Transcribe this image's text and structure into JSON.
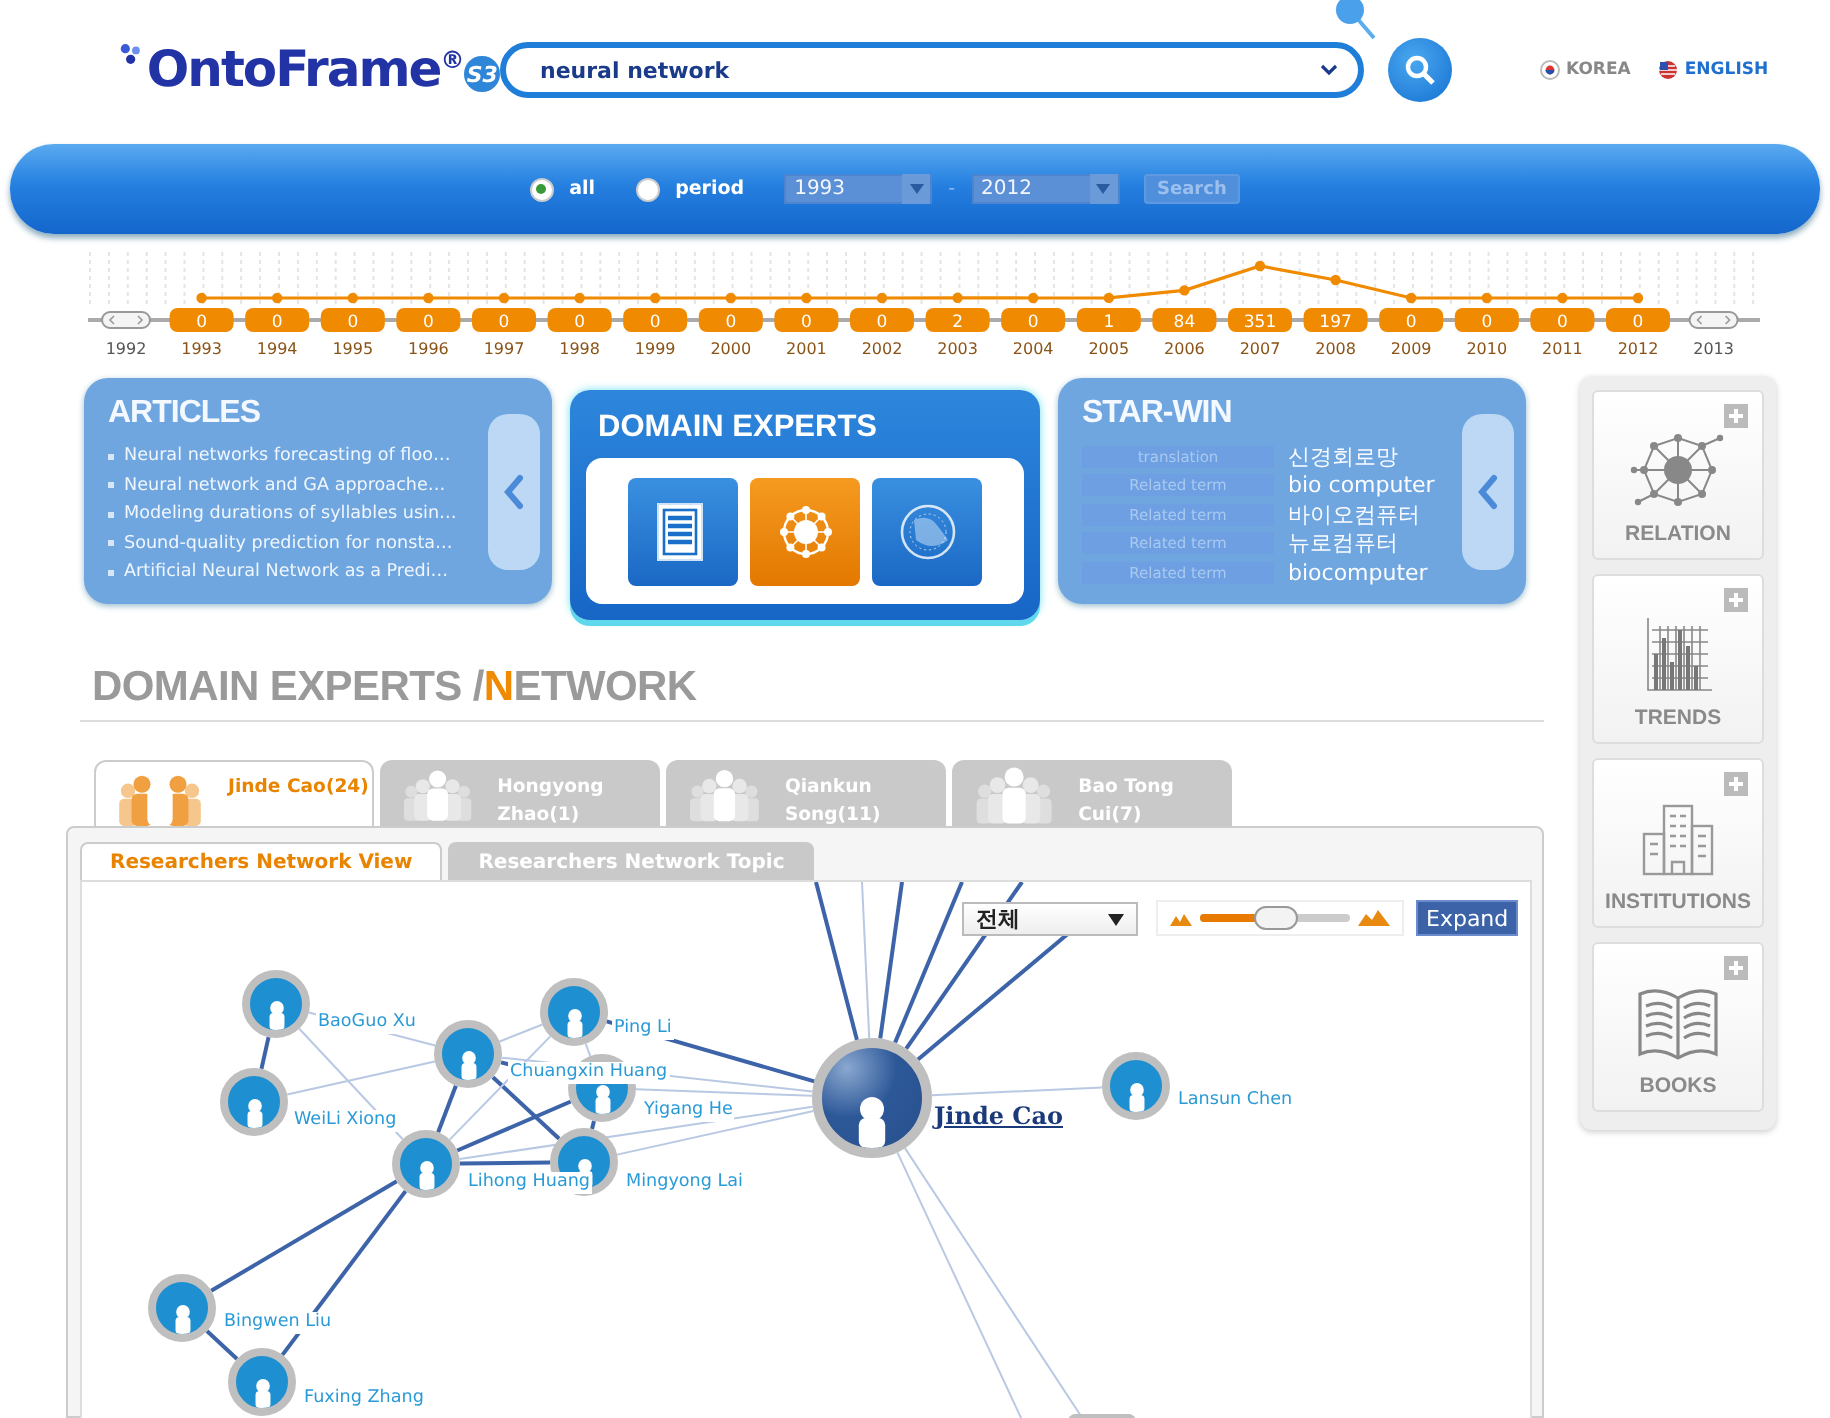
{
  "logo": {
    "name": "OntoFrame",
    "mark": "®",
    "edition": "S3"
  },
  "search": {
    "value": "neural network"
  },
  "languages": [
    {
      "label": "KOREA",
      "selected": false
    },
    {
      "label": "ENGLISH",
      "selected": true
    }
  ],
  "filter": {
    "range_options": [
      {
        "label": "all",
        "selected": true
      },
      {
        "label": "period",
        "selected": false
      }
    ],
    "from": "1993",
    "separator": "-",
    "to": "2012",
    "disabled": true,
    "button": "Search"
  },
  "timeline": {
    "start": "1992",
    "end": "2013",
    "chart_data": {
      "type": "line",
      "categories": [
        "1993",
        "1994",
        "1995",
        "1996",
        "1997",
        "1998",
        "1999",
        "2000",
        "2001",
        "2002",
        "2003",
        "2004",
        "2005",
        "2006",
        "2007",
        "2008",
        "2009",
        "2010",
        "2011",
        "2012"
      ],
      "values": [
        0,
        0,
        0,
        0,
        0,
        0,
        0,
        0,
        0,
        0,
        2,
        0,
        1,
        84,
        351,
        197,
        0,
        0,
        0,
        0
      ],
      "marker": "circle",
      "grid": true,
      "data_labels": true
    }
  },
  "articles": {
    "title": "ARTICLES",
    "items": [
      "Neural networks forecasting of floo…",
      "Neural network and GA approache…",
      "Modeling durations of syllables usin…",
      "Sound-quality prediction for nonsta…",
      "Artificial Neural Network as a Predi…"
    ]
  },
  "domain_experts": {
    "title": "DOMAIN EXPERTS",
    "views": [
      {
        "kind": "list",
        "selected": false
      },
      {
        "kind": "network",
        "selected": true
      },
      {
        "kind": "globe",
        "selected": false
      }
    ]
  },
  "star_win": {
    "title": "STAR-WIN",
    "terms": [
      {
        "tag": "translation",
        "term": "신경회로망"
      },
      {
        "tag": "Related term",
        "term": "bio computer"
      },
      {
        "tag": "Related term",
        "term": "바이오컴퓨터"
      },
      {
        "tag": "Related term",
        "term": "뉴로컴퓨터"
      },
      {
        "tag": "Related term",
        "term": "biocomputer"
      }
    ]
  },
  "sidebar": [
    {
      "kind": "relation",
      "label": "RELATION"
    },
    {
      "kind": "trends",
      "label": "TRENDS"
    },
    {
      "kind": "institutions",
      "label": "INSTITUTIONS"
    },
    {
      "kind": "books",
      "label": "BOOKS"
    }
  ],
  "section_title": {
    "text": "DOMAIN EXPERTS / ",
    "accent": "N",
    "rest": "ETWORK"
  },
  "experts": [
    {
      "name": "Jinde Cao(24)",
      "selected": true
    },
    {
      "name": "Hongyong Zhao(1)",
      "selected": false
    },
    {
      "name": "Qiankun Song(11)",
      "selected": false
    },
    {
      "name": "Bao Tong Cui(7)",
      "selected": false
    }
  ],
  "view_tabs": [
    {
      "label": "Researchers Network View",
      "selected": true
    },
    {
      "label": "Researchers Network Topic",
      "selected": false
    }
  ],
  "network": {
    "filter": "전체",
    "zoom": {
      "level": 0.5
    },
    "expand": "Expand",
    "nodes": [
      {
        "kind": "author",
        "name": "BaoGuo Xu"
      },
      {
        "kind": "author",
        "name": "Ping Li"
      },
      {
        "kind": "author",
        "name": "Chuangxin Huang"
      },
      {
        "kind": "author",
        "name": "Yigang He"
      },
      {
        "kind": "author",
        "name": "WeiLi Xiong"
      },
      {
        "kind": "center",
        "name": "Jinde Cao"
      },
      {
        "kind": "author",
        "name": "Lansun Chen"
      },
      {
        "kind": "author",
        "name": "Lihong Huang"
      },
      {
        "kind": "author",
        "name": "Mingyong Lai"
      },
      {
        "kind": "author",
        "name": "Bingwen Liu"
      },
      {
        "kind": "author",
        "name": "Fuxing Zhang"
      },
      {
        "kind": "author"
      }
    ]
  }
}
